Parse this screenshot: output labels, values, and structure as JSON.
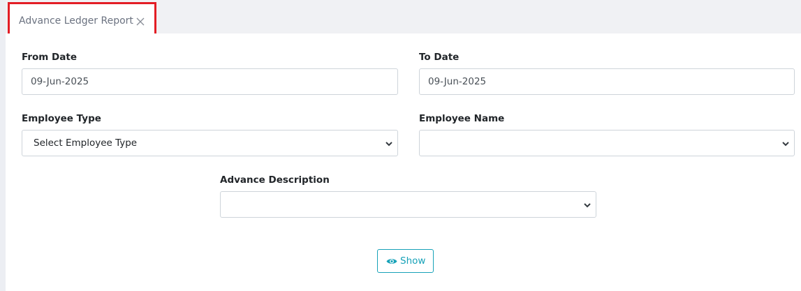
{
  "tab": {
    "title": "Advance Ledger Report",
    "close_icon": "close-icon"
  },
  "form": {
    "from_date": {
      "label": "From Date",
      "value": "09-Jun-2025"
    },
    "to_date": {
      "label": "To Date",
      "value": "09-Jun-2025"
    },
    "employee_type": {
      "label": "Employee Type",
      "selected": "Select Employee Type"
    },
    "employee_name": {
      "label": "Employee Name",
      "selected": ""
    },
    "advance_description": {
      "label": "Advance Description",
      "selected": ""
    }
  },
  "actions": {
    "show_label": "Show",
    "show_icon": "eye-icon"
  },
  "colors": {
    "accent": "#17a2b8",
    "highlight_border": "#e31d25",
    "tab_bar_bg": "#f0f1f4"
  }
}
